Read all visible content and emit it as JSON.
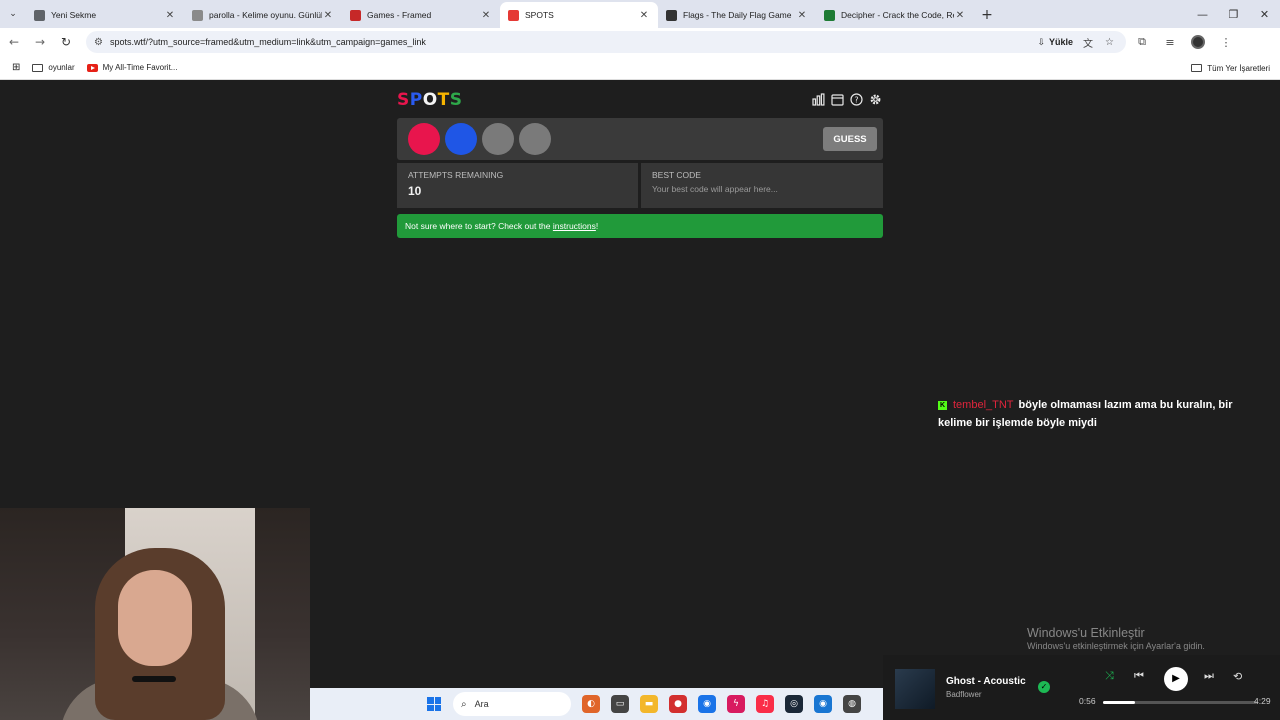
{
  "browser": {
    "tabs": [
      {
        "title": "Yeni Sekme",
        "favicon_color": "#5f6368"
      },
      {
        "title": "parolla - Kelime oyunu. Günlük",
        "favicon_color": "#8a8a8a"
      },
      {
        "title": "Games - Framed",
        "favicon_color": "#c62828"
      },
      {
        "title": "SPOTS",
        "favicon_color": "#e53935"
      },
      {
        "title": "Flags - The Daily Flag Game",
        "favicon_color": "#333333"
      },
      {
        "title": "Decipher - Crack the Code, Rev",
        "favicon_color": "#1e7b34"
      }
    ],
    "active_tab": 3,
    "url": "spots.wtf/?utm_source=framed&utm_medium=link&utm_campaign=games_link",
    "install_label": "Yükle",
    "bookmarks": [
      "oyunlar",
      "My All-Time Favorit..."
    ],
    "all_bookmarks_label": "Tüm Yer İşaretleri"
  },
  "game": {
    "logo_letters": [
      {
        "ch": "S",
        "color": "#e8154d"
      },
      {
        "ch": "P",
        "color": "#2a5bf0"
      },
      {
        "ch": "O",
        "color": "#f4f4f4"
      },
      {
        "ch": "T",
        "color": "#f6b400"
      },
      {
        "ch": "S",
        "color": "#2ea84a"
      }
    ],
    "pegs": [
      "#e8154d",
      "#1f56e6",
      "#7a7a7a",
      "#7a7a7a"
    ],
    "guess_label": "GUESS",
    "attempts_label": "ATTEMPTS REMAINING",
    "attempts_value": "10",
    "best_code_label": "BEST CODE",
    "best_code_hint": "Your best code will appear here...",
    "notice_text": "Not sure where to start? Check out the ",
    "notice_link": "instructions",
    "notice_end": "!"
  },
  "chat": {
    "username": "tembel_TNT",
    "message": "böyle olmaması lazım ama bu kuralın, bir kelime bir işlemde böyle miydi"
  },
  "windows": {
    "activate_title": "Windows'u Etkinleştir",
    "activate_sub": "Windows'u etkinleştirmek için Ayarlar'a gidin.",
    "search_placeholder": "Ara"
  },
  "music": {
    "song": "Ghost - Acoustic",
    "artist": "Badflower",
    "elapsed": "0:56",
    "duration": "4:29",
    "progress": 0.21
  }
}
